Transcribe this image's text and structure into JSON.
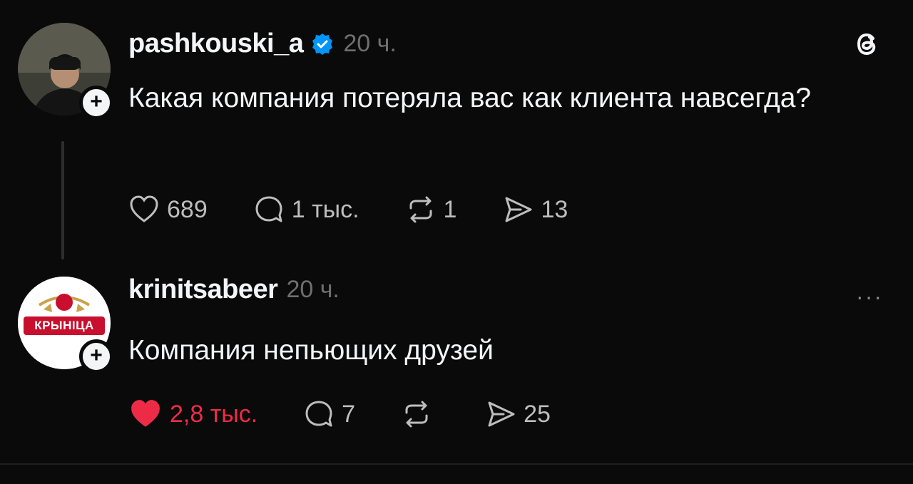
{
  "post1": {
    "username": "pashkouski_a",
    "verified": true,
    "time": "20 ч.",
    "text": "Какая компания потеряла вас как клиента навсегда?",
    "likes": "689",
    "comments": "1 тыс.",
    "reposts": "1",
    "shares": "13"
  },
  "post2": {
    "username": "krinitsabeer",
    "time": "20 ч.",
    "text": "Компания непьющих друзей",
    "logo_text": "КРЫНIЦА",
    "likes": "2,8 тыс.",
    "comments": "7",
    "reposts": "",
    "shares": "25",
    "liked": true
  },
  "more_icon": "···",
  "colors": {
    "background": "#0a0a0a",
    "text": "#f3f5f7",
    "muted": "#6f6f6f",
    "like_red": "#ee2b47",
    "verified_blue": "#0095f6"
  }
}
